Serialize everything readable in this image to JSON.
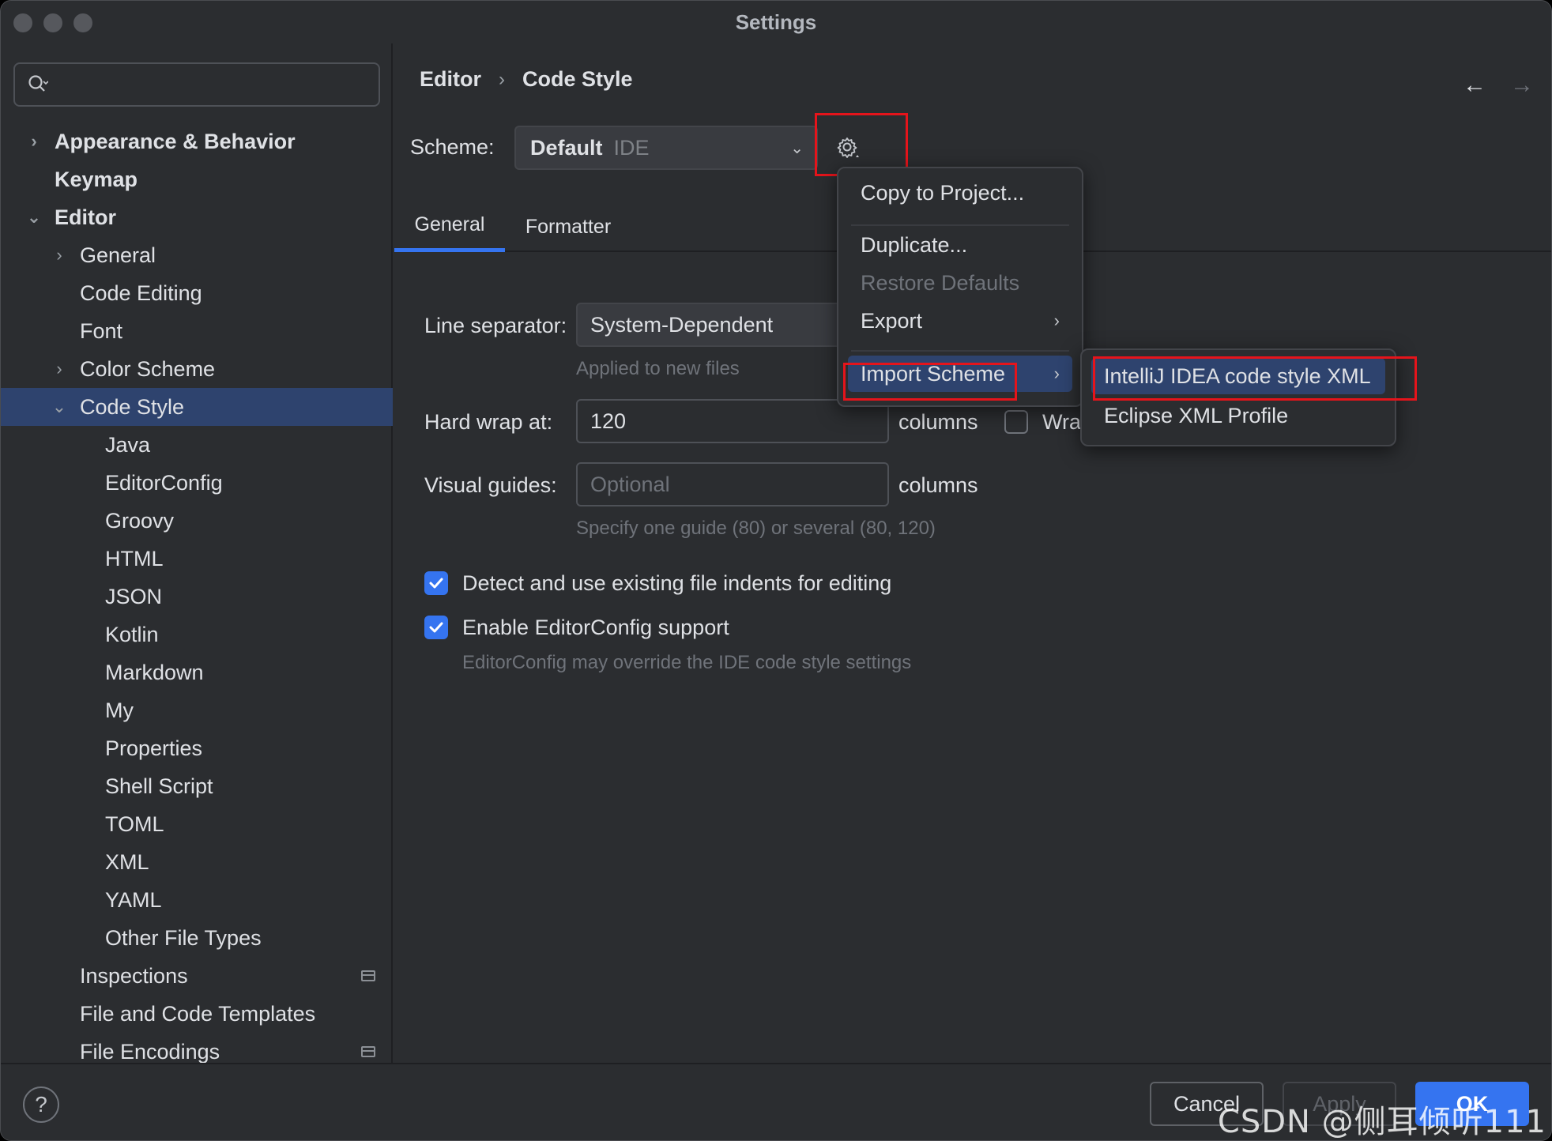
{
  "window": {
    "title": "Settings"
  },
  "search": {
    "placeholder": ""
  },
  "sidebar": {
    "items": [
      {
        "label": "Appearance & Behavior"
      },
      {
        "label": "Keymap"
      },
      {
        "label": "Editor"
      },
      {
        "label": "General"
      },
      {
        "label": "Code Editing"
      },
      {
        "label": "Font"
      },
      {
        "label": "Color Scheme"
      },
      {
        "label": "Code Style"
      },
      {
        "label": "Java"
      },
      {
        "label": "EditorConfig"
      },
      {
        "label": "Groovy"
      },
      {
        "label": "HTML"
      },
      {
        "label": "JSON"
      },
      {
        "label": "Kotlin"
      },
      {
        "label": "Markdown"
      },
      {
        "label": "My"
      },
      {
        "label": "Properties"
      },
      {
        "label": "Shell Script"
      },
      {
        "label": "TOML"
      },
      {
        "label": "XML"
      },
      {
        "label": "YAML"
      },
      {
        "label": "Other File Types"
      },
      {
        "label": "Inspections"
      },
      {
        "label": "File and Code Templates"
      },
      {
        "label": "File Encodings"
      }
    ]
  },
  "breadcrumb": {
    "parent": "Editor",
    "separator": "›",
    "current": "Code Style"
  },
  "nav": {
    "back": "←",
    "forward": "→"
  },
  "scheme": {
    "label": "Scheme:",
    "name": "Default",
    "sub": "IDE"
  },
  "tabs": [
    {
      "label": "General"
    },
    {
      "label": "Formatter"
    }
  ],
  "general": {
    "line_separator": {
      "label": "Line separator:",
      "value": "System-Dependent",
      "hint": "Applied to new files"
    },
    "hard_wrap": {
      "label": "Hard wrap at:",
      "value": "120",
      "unit": "columns",
      "wrap_label": "Wra"
    },
    "visual_guides": {
      "label": "Visual guides:",
      "placeholder": "Optional",
      "unit": "columns",
      "hint": "Specify one guide (80) or several (80, 120)"
    },
    "detect_indents": {
      "label": "Detect and use existing file indents for editing",
      "checked": true
    },
    "editorconfig": {
      "label": "Enable EditorConfig support",
      "checked": true,
      "hint": "EditorConfig may override the IDE code style settings"
    }
  },
  "scheme_menu": {
    "copy": "Copy to Project...",
    "duplicate": "Duplicate...",
    "restore": "Restore Defaults",
    "export": "Export",
    "import": "Import Scheme"
  },
  "import_submenu": {
    "intellij": "IntelliJ IDEA code style XML",
    "eclipse": "Eclipse XML Profile"
  },
  "buttons": {
    "help": "?",
    "cancel": "Cancel",
    "apply": "Apply",
    "ok": "OK"
  },
  "watermark": "CSDN @侧耳倾听111",
  "colors": {
    "accent": "#3574f0",
    "selection": "#2e436e",
    "highlight_box": "#e5141b",
    "background": "#2b2d30"
  }
}
